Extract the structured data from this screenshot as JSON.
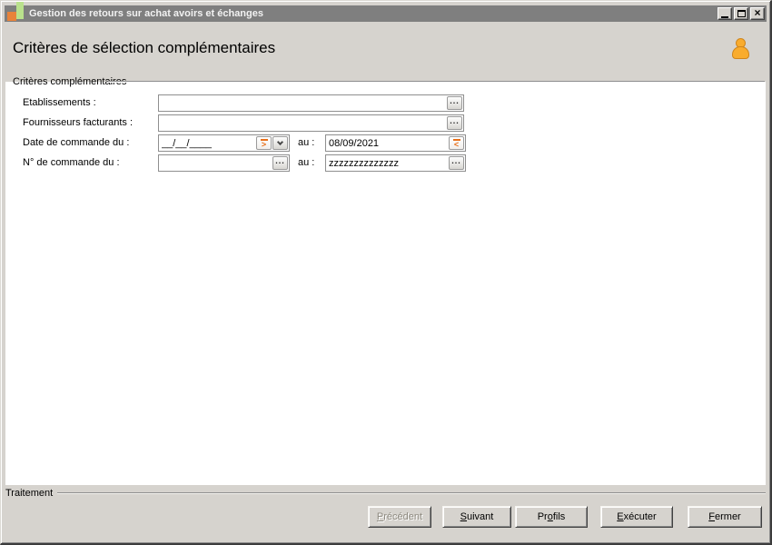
{
  "window": {
    "title": "Gestion des retours sur achat avoirs et échanges"
  },
  "header": {
    "title": "Critères de sélection complémentaires"
  },
  "criteria": {
    "legend": "Critères complémentaires",
    "etablissements": {
      "label": "Etablissements :",
      "value": ""
    },
    "fournisseurs": {
      "label": "Fournisseurs facturants :",
      "value": ""
    },
    "date_commande": {
      "label": "Date de commande du :",
      "from_value": "__/__/____",
      "to_label": "au :",
      "to_value": "08/09/2021"
    },
    "num_commande": {
      "label": "N° de commande du :",
      "from_value": "",
      "to_label": "au :",
      "to_value": "zzzzzzzzzzzzzz"
    }
  },
  "footer": {
    "legend": "Traitement",
    "buttons": {
      "precedent": {
        "pre": "",
        "key": "P",
        "post": "récédent",
        "disabled": true
      },
      "suivant": {
        "pre": "",
        "key": "S",
        "post": "uivant",
        "disabled": false
      },
      "profils": {
        "pre": "Pr",
        "key": "o",
        "post": "fils",
        "disabled": false
      },
      "executer": {
        "pre": "",
        "key": "E",
        "post": "xécuter",
        "disabled": false
      },
      "fermer": {
        "pre": "",
        "key": "F",
        "post": "ermer",
        "disabled": false
      }
    }
  },
  "icons": {
    "browse_glyph": "...",
    "next_glyph": ">",
    "prev_glyph": "<",
    "close_glyph": "×"
  },
  "colors": {
    "titlebar": "#7f7f7f",
    "window_bg": "#d6d3ce",
    "panel_bg": "#ffffff",
    "accent_orange": "#e8701a",
    "app_icon_orange": "#e8833a",
    "app_icon_green": "#b9e18c",
    "user_icon_orange": "#f9ac2e"
  }
}
